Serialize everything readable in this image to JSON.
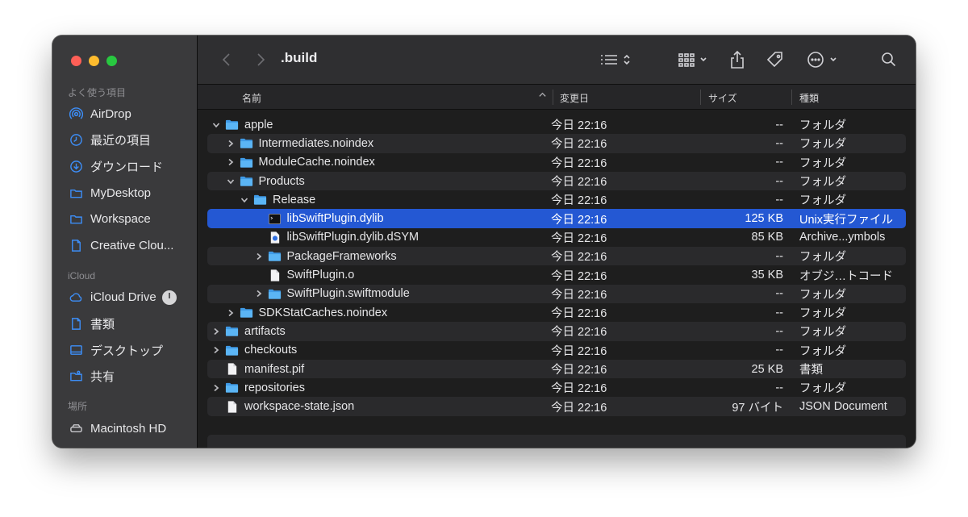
{
  "window": {
    "title": ".build"
  },
  "sidebar": {
    "sections": [
      {
        "label": "よく使う項目",
        "items": [
          {
            "label": "AirDrop",
            "icon": "airdrop-icon"
          },
          {
            "label": "最近の項目",
            "icon": "clock-icon"
          },
          {
            "label": "ダウンロード",
            "icon": "download-icon"
          },
          {
            "label": "MyDesktop",
            "icon": "folder-icon"
          },
          {
            "label": "Workspace",
            "icon": "folder-icon"
          },
          {
            "label": "Creative Clou...",
            "icon": "document-icon"
          }
        ]
      },
      {
        "label": "iCloud",
        "items": [
          {
            "label": "iCloud Drive",
            "icon": "cloud-icon"
          },
          {
            "label": "書類",
            "icon": "document-icon"
          },
          {
            "label": "デスクトップ",
            "icon": "desktop-icon"
          },
          {
            "label": "共有",
            "icon": "shared-folder-icon"
          }
        ]
      },
      {
        "label": "場所",
        "items": [
          {
            "label": "Macintosh HD",
            "icon": "disk-icon"
          }
        ]
      }
    ]
  },
  "columns": {
    "name": "名前",
    "date": "変更日",
    "size": "サイズ",
    "kind": "種類"
  },
  "rows": [
    {
      "name": "apple",
      "type": "folder",
      "depth": 0,
      "disclosure": "open",
      "date": "今日 22:16",
      "size": "--",
      "kind": "フォルダ"
    },
    {
      "name": "Intermediates.noindex",
      "type": "folder",
      "depth": 1,
      "disclosure": "closed",
      "date": "今日 22:16",
      "size": "--",
      "kind": "フォルダ"
    },
    {
      "name": "ModuleCache.noindex",
      "type": "folder",
      "depth": 1,
      "disclosure": "closed",
      "date": "今日 22:16",
      "size": "--",
      "kind": "フォルダ"
    },
    {
      "name": "Products",
      "type": "folder",
      "depth": 1,
      "disclosure": "open",
      "date": "今日 22:16",
      "size": "--",
      "kind": "フォルダ"
    },
    {
      "name": "Release",
      "type": "folder",
      "depth": 2,
      "disclosure": "open",
      "date": "今日 22:16",
      "size": "--",
      "kind": "フォルダ"
    },
    {
      "name": "libSwiftPlugin.dylib",
      "type": "exec",
      "depth": 3,
      "disclosure": "none",
      "date": "今日 22:16",
      "size": "125 KB",
      "kind": "Unix実行ファイル",
      "selected": true
    },
    {
      "name": "libSwiftPlugin.dylib.dSYM",
      "type": "archive",
      "depth": 3,
      "disclosure": "none",
      "date": "今日 22:16",
      "size": "85 KB",
      "kind": "Archive...ymbols"
    },
    {
      "name": "PackageFrameworks",
      "type": "folder",
      "depth": 3,
      "disclosure": "closed",
      "date": "今日 22:16",
      "size": "--",
      "kind": "フォルダ"
    },
    {
      "name": "SwiftPlugin.o",
      "type": "file",
      "depth": 3,
      "disclosure": "none",
      "date": "今日 22:16",
      "size": "35 KB",
      "kind": "オブジ…トコード"
    },
    {
      "name": "SwiftPlugin.swiftmodule",
      "type": "folder",
      "depth": 3,
      "disclosure": "closed",
      "date": "今日 22:16",
      "size": "--",
      "kind": "フォルダ"
    },
    {
      "name": "SDKStatCaches.noindex",
      "type": "folder",
      "depth": 1,
      "disclosure": "closed",
      "date": "今日 22:16",
      "size": "--",
      "kind": "フォルダ"
    },
    {
      "name": "artifacts",
      "type": "folder",
      "depth": 0,
      "disclosure": "closed",
      "date": "今日 22:16",
      "size": "--",
      "kind": "フォルダ"
    },
    {
      "name": "checkouts",
      "type": "folder",
      "depth": 0,
      "disclosure": "closed",
      "date": "今日 22:16",
      "size": "--",
      "kind": "フォルダ"
    },
    {
      "name": "manifest.pif",
      "type": "file",
      "depth": 0,
      "disclosure": "none",
      "date": "今日 22:16",
      "size": "25 KB",
      "kind": "書類"
    },
    {
      "name": "repositories",
      "type": "folder",
      "depth": 0,
      "disclosure": "closed",
      "date": "今日 22:16",
      "size": "--",
      "kind": "フォルダ"
    },
    {
      "name": "workspace-state.json",
      "type": "file",
      "depth": 0,
      "disclosure": "none",
      "date": "今日 22:16",
      "size": "97 バイト",
      "kind": "JSON Document"
    }
  ],
  "colors": {
    "accent": "#2458d3",
    "folder": "#49a6f0",
    "sidebar_icon": "#3d8ef7"
  }
}
